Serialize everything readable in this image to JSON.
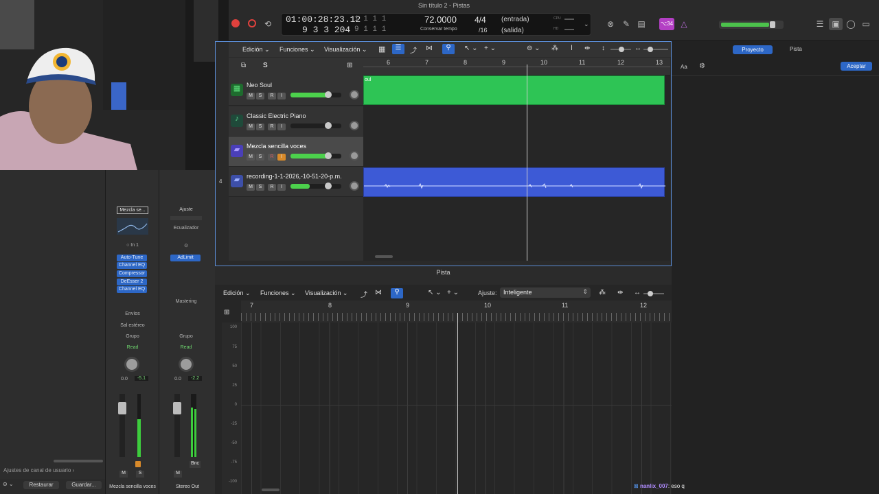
{
  "window": {
    "title": "Sin título 2 - Pistas"
  },
  "lcd": {
    "time": "01:00:28:23.12",
    "bars_beats": "9  3  3 204",
    "locator_top": "1  1  1   1",
    "locator_bottom": "9  1  1   1",
    "tempo": "72.0000",
    "tempo_label": "Conservar tempo",
    "signature_top": "4/4",
    "signature_bottom": "/16",
    "input_label": "(entrada)",
    "output_label": "(salida)",
    "cpu_label": "CPU",
    "hd_label": "HD"
  },
  "key_badge": "⌥34",
  "tracks_toolbar": {
    "edicion": "Edición",
    "funciones": "Funciones",
    "visualizacion": "Visualización"
  },
  "right_tabs": {
    "proyecto": "Proyecto",
    "pista": "Pista",
    "aa": "Aa",
    "aceptar": "Aceptar"
  },
  "ruler_bars": [
    "6",
    "7",
    "8",
    "9",
    "10",
    "11",
    "12",
    "13"
  ],
  "tracks": [
    {
      "num": "",
      "name": "Neo Soul",
      "fader": 0.75,
      "color": "#2ec455"
    },
    {
      "num": "",
      "name": "Classic Electric Piano",
      "fader": 0.75,
      "color": "#2ec455"
    },
    {
      "num": "",
      "name": "Mezcla sencilla voces",
      "fader": 0.75,
      "color": "#6e5be8"
    },
    {
      "num": "4",
      "name": "recording-1-1-2026,-10-51-20-p.m.",
      "fader": 0.4,
      "color": "#3d5ad6"
    }
  ],
  "track_buttons": {
    "m": "M",
    "s": "S",
    "r": "R",
    "i": "I"
  },
  "region_label": "oul",
  "inspector": {
    "s_label": "S",
    "ch1": {
      "setting": "Mezcla se...",
      "input": "In 1",
      "plugins": [
        "Auto-Tune",
        "Channel EQ",
        "Compressor",
        "DeEsser 2",
        "Channel EQ"
      ],
      "sends": "Envíos",
      "output": "Sal estéreo",
      "group": "Grupo",
      "automation": "Read",
      "vol": "0.0",
      "peak": "-5.1",
      "m": "M",
      "s": "S",
      "name": "Mezcla sencilla voces",
      "meter": 0.6
    },
    "ch2": {
      "setting": "Ajuste",
      "eq": "Ecualizador",
      "plugins": [
        "AdLimit"
      ],
      "mastering": "Mastering",
      "group": "Grupo",
      "automation": "Read",
      "vol": "0.0",
      "peak": "-2.2",
      "m": "M",
      "bnc": "Bnc",
      "name": "Stereo Out",
      "meter": 0.8
    },
    "user_settings": "Ajustes de canal de usuario ›",
    "restaurar": "Restaurar",
    "guardar": "Guardar..."
  },
  "editor": {
    "title": "Pista",
    "edicion": "Edición",
    "funciones": "Funciones",
    "visualizacion": "Visualización",
    "ajuste_label": "Ajuste:",
    "ajuste_value": "Inteligente",
    "bars": [
      "7",
      "8",
      "9",
      "10",
      "11",
      "12"
    ],
    "yticks": [
      "100",
      "75",
      "50",
      "25",
      "0",
      "-25",
      "-50",
      "-75",
      "-100"
    ]
  },
  "chat": {
    "user": "nanlix_007",
    "message": ": eso q"
  },
  "colors": {
    "accent": "#2d67c6",
    "green": "#2ec455",
    "audio": "#3d5ad6",
    "selection": "#5b8dd6"
  }
}
